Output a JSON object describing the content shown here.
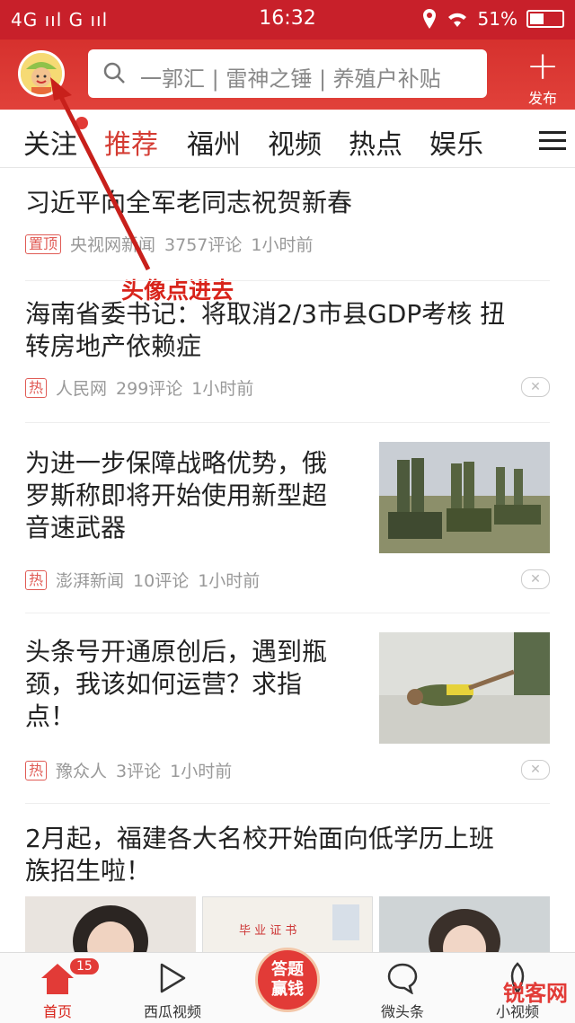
{
  "status": {
    "signal_left": "4G ııl G ııl",
    "time": "16:32",
    "battery": "51%",
    "battery_level": 0.51
  },
  "header": {
    "search_placeholder": "一郭汇 | 雷神之锤 | 养殖户补贴",
    "publish_label": "发布"
  },
  "tabs": [
    "关注",
    "推荐",
    "福州",
    "视频",
    "热点",
    "娱乐"
  ],
  "active_tab": 1,
  "annotation": "头像点进去",
  "news": [
    {
      "title": "习近平向全军老同志祝贺新春",
      "tag": "置顶",
      "source": "央视网新闻",
      "comments": "3757评论",
      "time": "1小时前"
    },
    {
      "title_l1": "海南省委书记：将取消2/3市县GDP考核 扭",
      "title_l2": "转房地产依赖症",
      "tag": "热",
      "source": "人民网",
      "comments": "299评论",
      "time": "1小时前"
    },
    {
      "title_l1": "为进一步保障战略优势，俄",
      "title_l2": "罗斯称即将开始使用新型超",
      "title_l3": "音速武器",
      "tag": "热",
      "source": "澎湃新闻",
      "comments": "10评论",
      "time": "1小时前"
    },
    {
      "title_l1": "头条号开通原创后，遇到瓶",
      "title_l2": "颈，我该如何运营？求指",
      "title_l3": "点！",
      "tag": "热",
      "source": "豫众人",
      "comments": "3评论",
      "time": "1小时前"
    },
    {
      "title_l1": "2月起，福建各大名校开始面向低学历上班",
      "title_l2": "族招生啦！"
    }
  ],
  "cert_text": "毕 业 证 书",
  "bottom_nav": [
    {
      "label": "首页",
      "badge": "15"
    },
    {
      "label": "西瓜视频"
    },
    {
      "label_l1": "答题",
      "label_l2": "赢钱"
    },
    {
      "label": "微头条"
    },
    {
      "label": "小视频"
    }
  ],
  "watermark": "锐客网",
  "colors": {
    "accent": "#d43c33",
    "header": "#d6312e"
  }
}
